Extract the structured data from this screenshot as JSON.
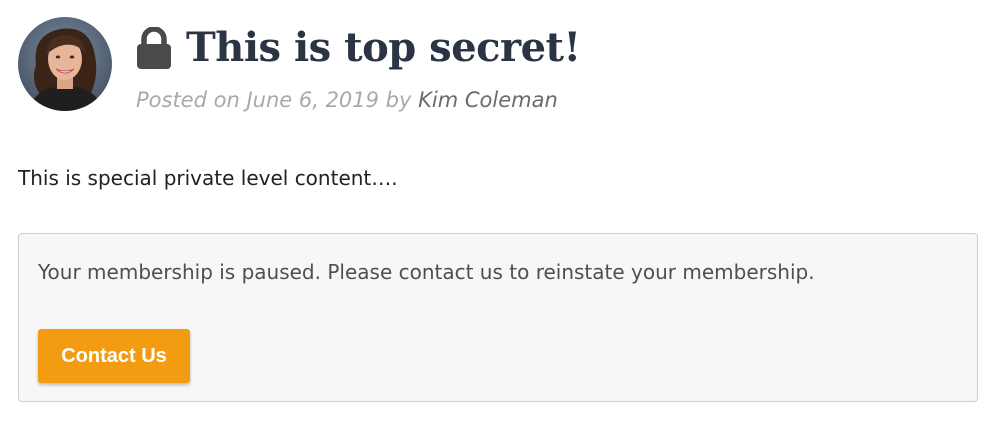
{
  "post": {
    "title": "This is top secret!",
    "lock_icon": "lock-icon",
    "meta_prefix": "Posted on June 6, 2019 by ",
    "author": "Kim Coleman",
    "content": "This is special private level content…."
  },
  "notice": {
    "message": "Your membership is paused. Please contact us to reinstate your membership.",
    "button_label": "Contact Us",
    "button_color": "#f39c12"
  },
  "colors": {
    "title": "#2b3445",
    "meta": "#a9a9a9",
    "author": "#6b6b6b",
    "notice_background": "#f7f7f7",
    "notice_border": "#cfcfcf"
  }
}
